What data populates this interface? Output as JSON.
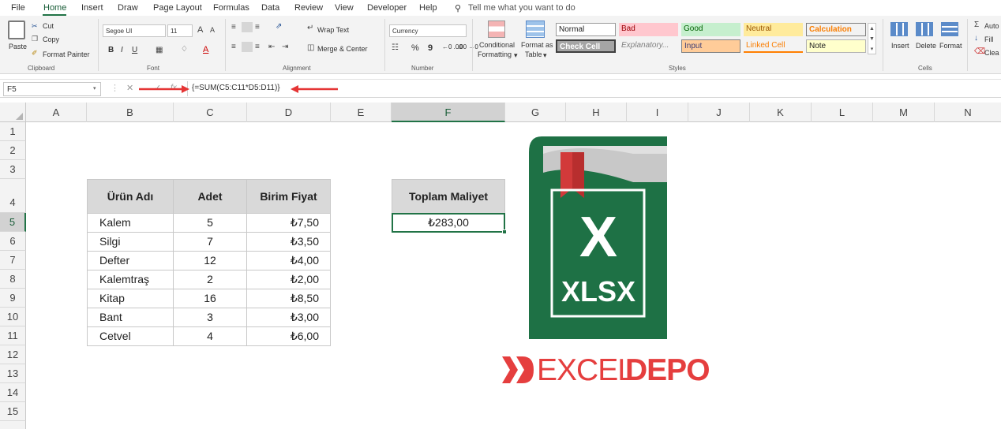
{
  "menu": {
    "tabs": [
      "File",
      "Home",
      "Insert",
      "Draw",
      "Page Layout",
      "Formulas",
      "Data",
      "Review",
      "View",
      "Developer",
      "Help"
    ],
    "tell_me": "Tell me what you want to do"
  },
  "ribbon": {
    "clipboard": {
      "paste": "Paste",
      "cut": "Cut",
      "copy": "Copy",
      "format_painter": "Format Painter",
      "group": "Clipboard"
    },
    "font": {
      "name": "Segoe UI",
      "size": "11",
      "bold": "B",
      "italic": "I",
      "underline": "U",
      "group": "Font"
    },
    "alignment": {
      "wrap": "Wrap Text",
      "merge": "Merge & Center",
      "group": "Alignment"
    },
    "number": {
      "format": "Currency",
      "percent": "%",
      "comma": "9",
      "dec_inc": "←0 .00",
      "dec_dec": ".00 →0",
      "group": "Number"
    },
    "conditional": {
      "l1": "Conditional",
      "l2": "Formatting",
      "arrow": "▾"
    },
    "format_table": {
      "l1": "Format as",
      "l2": "Table",
      "arrow": "▾"
    },
    "styles": {
      "normal": "Normal",
      "bad": "Bad",
      "good": "Good",
      "neutral": "Neutral",
      "calculation": "Calculation",
      "check": "Check Cell",
      "explanatory": "Explanatory...",
      "input": "Input",
      "linked": "Linked Cell",
      "note": "Note",
      "group": "Styles"
    },
    "cells": {
      "insert": "Insert",
      "delete": "Delete",
      "format": "Format",
      "group": "Cells"
    },
    "editing": {
      "autosum": "Auto",
      "fill": "Fill",
      "clear": "Clea"
    }
  },
  "formula_bar": {
    "namebox": "F5",
    "formula": "{=SUM(C5:C11*D5:D11)}",
    "cancel": "✕",
    "enter": "✓",
    "fx": "fx"
  },
  "columns": [
    "A",
    "B",
    "C",
    "D",
    "E",
    "F",
    "G",
    "H",
    "I",
    "J",
    "K",
    "L",
    "M",
    "N"
  ],
  "rows": [
    "1",
    "2",
    "3",
    "4",
    "5",
    "6",
    "7",
    "8",
    "9",
    "10",
    "11",
    "12",
    "13",
    "14",
    "15"
  ],
  "table": {
    "headers": [
      "Ürün Adı",
      "Adet",
      "Birim Fiyat"
    ],
    "rows": [
      [
        "Kalem",
        "5",
        "₺7,50"
      ],
      [
        "Silgi",
        "7",
        "₺3,50"
      ],
      [
        "Defter",
        "12",
        "₺4,00"
      ],
      [
        "Kalemtraş",
        "2",
        "₺2,00"
      ],
      [
        "Kitap",
        "16",
        "₺8,50"
      ],
      [
        "Bant",
        "3",
        "₺3,00"
      ],
      [
        "Cetvel",
        "4",
        "₺6,00"
      ]
    ]
  },
  "result": {
    "header": "Toplam Maliyet",
    "value": "₺283,00"
  },
  "logo": {
    "letter": "X",
    "ext": "XLSX",
    "brand_a": "EXCEL",
    "brand_b": "DEPO"
  },
  "colors": {
    "excel_green": "#217346",
    "logo_green": "#1e7145",
    "brand_red": "#e53e3e",
    "arrow_red": "#e53535"
  }
}
